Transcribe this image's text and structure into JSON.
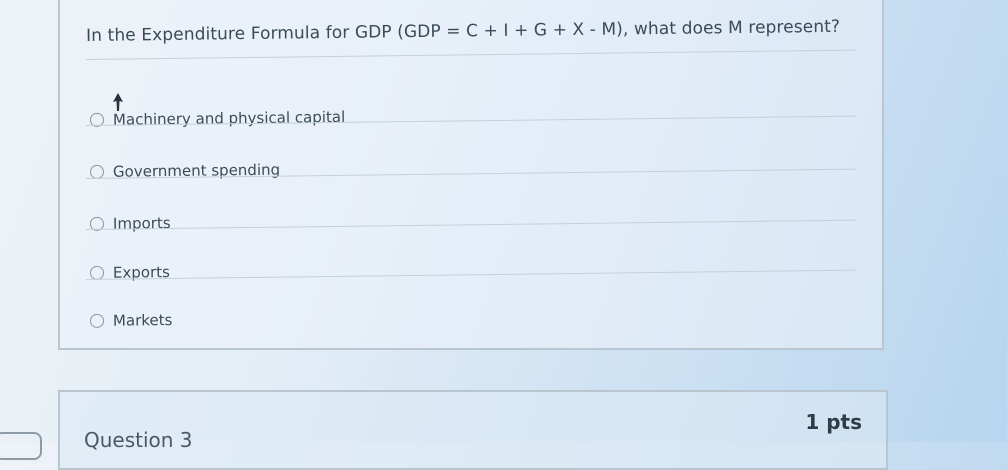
{
  "question": {
    "text": "In the Expenditure Formula for GDP (GDP = C + I + G + X - M), what does M represent?",
    "answers": [
      "Machinery and physical capital",
      "Government spending",
      "Imports",
      "Exports",
      "Markets"
    ]
  },
  "next_question": {
    "title": "Question 3",
    "points": "1 pts"
  },
  "icons": {
    "cursor": "mouse-pointer-icon",
    "radio": "radio-circle-icon"
  }
}
